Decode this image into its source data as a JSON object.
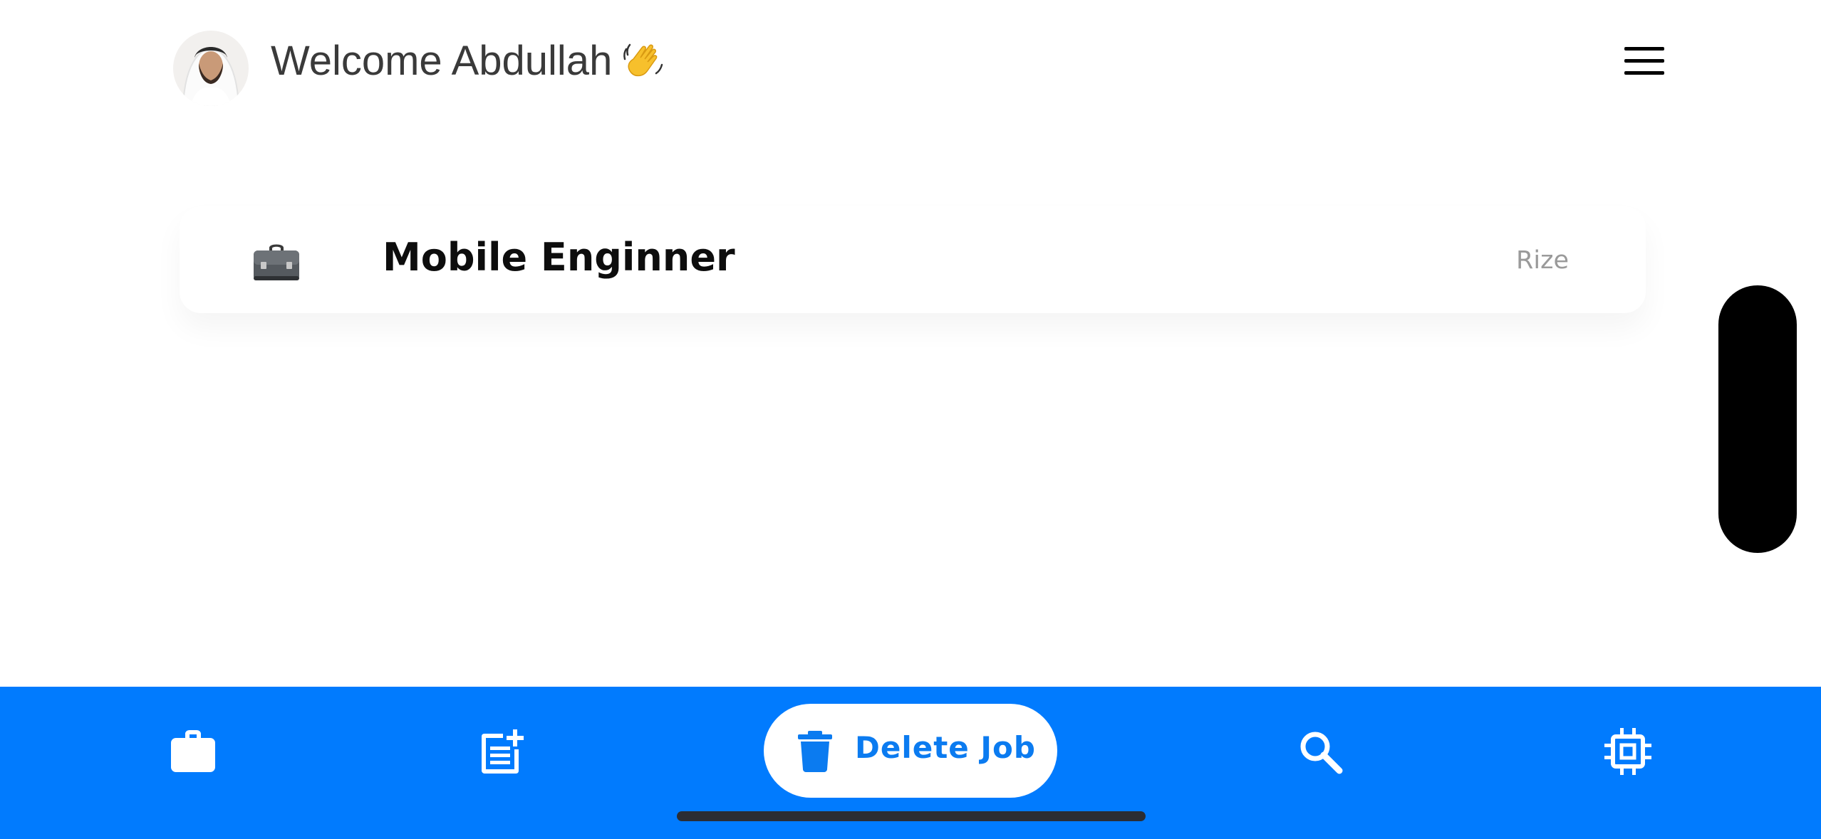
{
  "header": {
    "welcome_text": "Welcome Abdullah",
    "avatar_icon": "user-avatar",
    "wave_icon": "waving-hand-icon",
    "menu_icon": "hamburger-menu-icon"
  },
  "jobs": [
    {
      "title": "Mobile Enginner",
      "company": "Rize",
      "icon": "briefcase-icon"
    }
  ],
  "bottom_nav": {
    "items": [
      {
        "icon": "briefcase-icon"
      },
      {
        "icon": "post-add-icon"
      },
      {
        "icon": "trash-icon",
        "label": "Delete Job"
      },
      {
        "icon": "search-icon"
      },
      {
        "icon": "chip-icon"
      }
    ]
  },
  "colors": {
    "accent": "#017bfe",
    "delete_label": "#0b7bf0",
    "side_handle": "#000000",
    "home_indicator": "#2b2d33"
  }
}
